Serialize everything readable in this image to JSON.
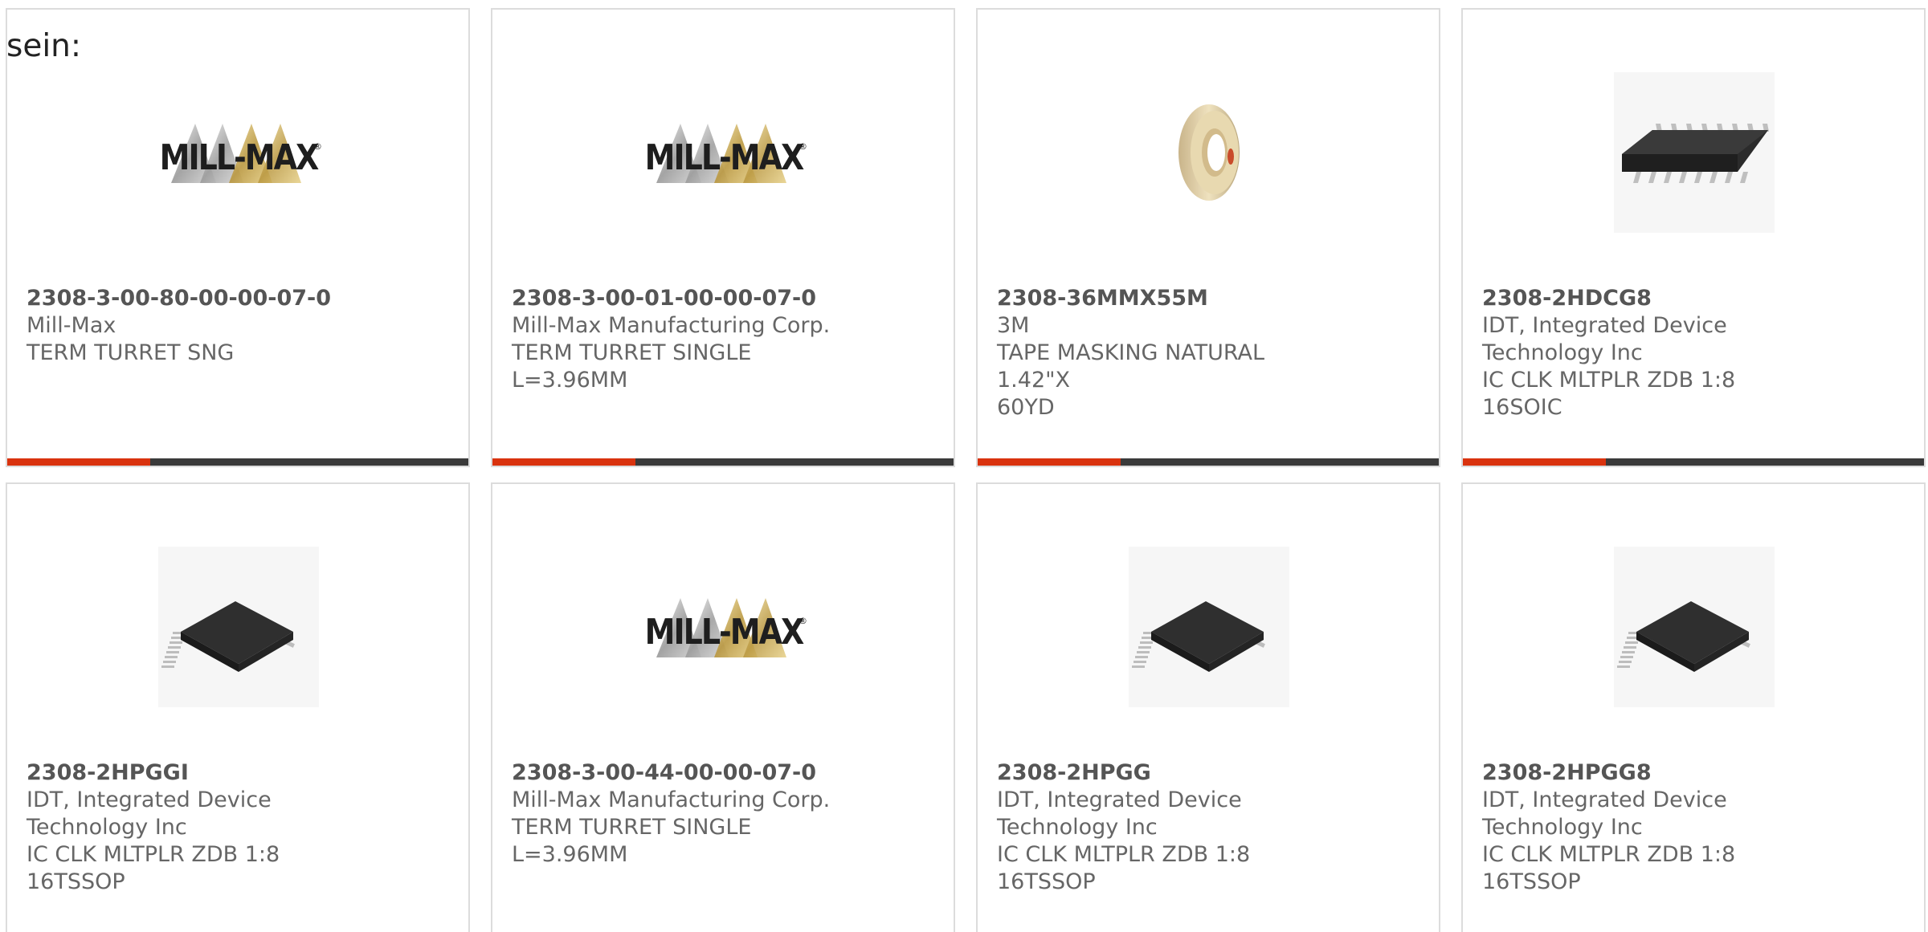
{
  "intro_text": "sein:",
  "colors": {
    "accent": "#d9330e",
    "track": "#3a3a3a",
    "border": "#dcdcdc"
  },
  "products": [
    {
      "part_number": "2308-3-00-80-00-00-07-0",
      "manufacturer": [
        "Mill-Max"
      ],
      "description": [
        "TERM TURRET SNG"
      ],
      "image": "mill-max-logo",
      "progress": 0.31
    },
    {
      "part_number": "2308-3-00-01-00-00-07-0",
      "manufacturer": [
        "Mill-Max Manufacturing Corp."
      ],
      "description": [
        "TERM TURRET SINGLE L=3.96MM"
      ],
      "image": "mill-max-logo",
      "progress": 0.31
    },
    {
      "part_number": "2308-36MMX55M",
      "manufacturer": [
        "3M"
      ],
      "description": [
        "TAPE MASKING NATURAL 1.42\"X",
        "60YD"
      ],
      "image": "masking-tape-roll",
      "progress": 0.31
    },
    {
      "part_number": "2308-2HDCG8",
      "manufacturer": [
        "IDT, Integrated Device",
        "Technology Inc"
      ],
      "description": [
        "IC CLK MLTPLR ZDB 1:8 16SOIC"
      ],
      "image": "soic-chip",
      "progress": 0.31
    },
    {
      "part_number": "2308-2HPGGI",
      "manufacturer": [
        "IDT, Integrated Device",
        "Technology Inc"
      ],
      "description": [
        "IC CLK MLTPLR ZDB 1:8",
        "16TSSOP"
      ],
      "image": "tssop-chip",
      "progress": null
    },
    {
      "part_number": "2308-3-00-44-00-00-07-0",
      "manufacturer": [
        "Mill-Max Manufacturing Corp."
      ],
      "description": [
        "TERM TURRET SINGLE L=3.96MM"
      ],
      "image": "mill-max-logo",
      "progress": null
    },
    {
      "part_number": "2308-2HPGG",
      "manufacturer": [
        "IDT, Integrated Device",
        "Technology Inc"
      ],
      "description": [
        "IC CLK MLTPLR ZDB 1:8",
        "16TSSOP"
      ],
      "image": "tssop-chip",
      "progress": null
    },
    {
      "part_number": "2308-2HPGG8",
      "manufacturer": [
        "IDT, Integrated Device",
        "Technology Inc"
      ],
      "description": [
        "IC CLK MLTPLR ZDB 1:8",
        "16TSSOP"
      ],
      "image": "tssop-chip",
      "progress": null
    }
  ],
  "logo_text": "MILL-MAX"
}
